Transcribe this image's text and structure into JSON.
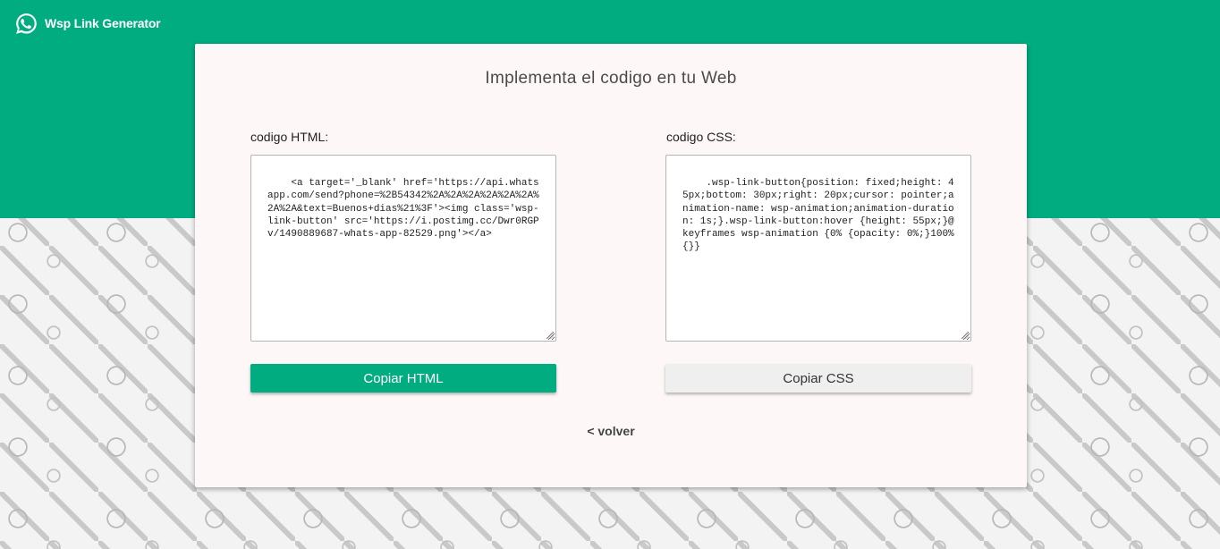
{
  "app": {
    "title": "Wsp Link Generator",
    "icon": "whatsapp-icon"
  },
  "colors": {
    "brand_green": "#00ac80",
    "card_bg": "#fdf8f7"
  },
  "card": {
    "title": "Implementa el codigo en tu Web",
    "html_section": {
      "label": "codigo HTML:",
      "code": "<a target='_blank' href='https://api.whatsapp.com/send?phone=%2B54342%2A%2A%2A%2A%2A%2A%2A%2A&text=Buenos+dias%21%3F'><img class='wsp-link-button' src='https://i.postimg.cc/Dwr0RGPv/1490889687-whats-app-82529.png'></a>",
      "button_label": "Copiar HTML"
    },
    "css_section": {
      "label": "codigo CSS:",
      "code": ".wsp-link-button{position: fixed;height: 45px;bottom: 30px;right: 20px;cursor: pointer;animation-name: wsp-animation;animation-duration: 1s;}.wsp-link-button:hover {height: 55px;}@keyframes wsp-animation {0% {opacity: 0%;}100% {}}",
      "button_label": "Copiar CSS"
    },
    "back_link": "< volver"
  }
}
